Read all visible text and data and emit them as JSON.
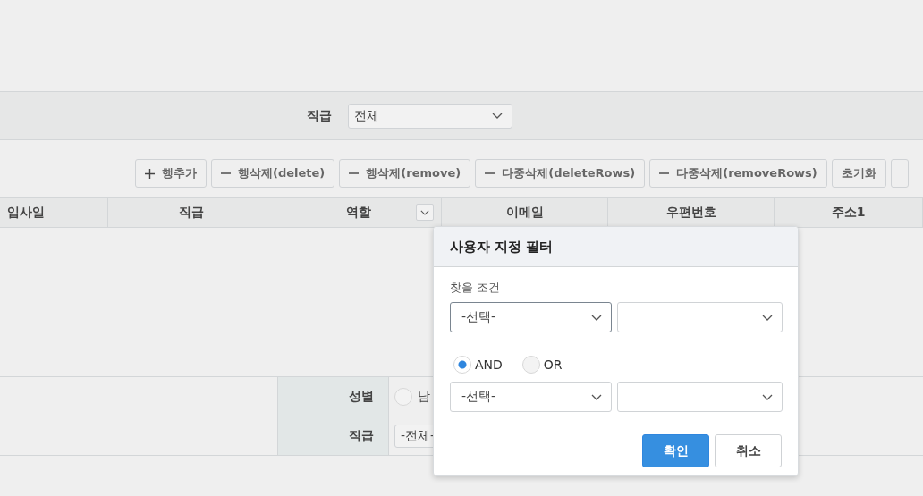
{
  "search_bar": {
    "label": "직급",
    "value": "전체"
  },
  "toolbar": [
    {
      "kind": "add",
      "label": "행추가"
    },
    {
      "kind": "remove",
      "label": "행삭제(delete)"
    },
    {
      "kind": "remove",
      "label": "행삭제(remove)"
    },
    {
      "kind": "remove",
      "label": "다중삭제(deleteRows)"
    },
    {
      "kind": "remove",
      "label": "다중삭제(removeRows)"
    },
    {
      "kind": "plain",
      "label": "초기화"
    }
  ],
  "table": {
    "columns": [
      {
        "label": "입사일",
        "filter": false
      },
      {
        "label": "직급",
        "filter": false
      },
      {
        "label": "역할",
        "filter": true
      },
      {
        "label": "이메일",
        "filter": false
      },
      {
        "label": "우편번호",
        "filter": false
      },
      {
        "label": "주소1",
        "filter": false
      }
    ]
  },
  "form": [
    {
      "label": "성별",
      "kind": "radio",
      "value": "남",
      "selected": false
    },
    {
      "label": "직급",
      "kind": "select",
      "value": "-전체-"
    }
  ],
  "filter_popup": {
    "title": "사용자 지정 필터",
    "condition_label": "찾을 조건",
    "conditions": [
      {
        "operator": "-선택-",
        "focused": true
      },
      {
        "operator": "-선택-",
        "focused": false
      }
    ],
    "logic": [
      {
        "label": "AND",
        "selected": true
      },
      {
        "label": "OR",
        "selected": false
      }
    ],
    "buttons": [
      {
        "label": "확인",
        "kind": "primary"
      },
      {
        "label": "취소",
        "kind": "secondary"
      }
    ]
  }
}
